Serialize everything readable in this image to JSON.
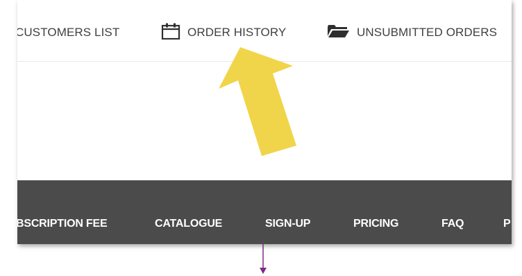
{
  "top_nav": {
    "customers_list": "CUSTOMERS LIST",
    "order_history": "ORDER HISTORY",
    "unsubmitted_orders": "UNSUBMITTED ORDERS",
    "icons": {
      "order_history": "calendar-icon",
      "unsubmitted_orders": "folder-open-icon"
    }
  },
  "main_nav": {
    "items": [
      {
        "label": "BSCRIPTION FEE"
      },
      {
        "label": "CATALOGUE"
      },
      {
        "label": "SIGN-UP"
      },
      {
        "label": "PRICING"
      },
      {
        "label": "FAQ"
      },
      {
        "label": "P"
      }
    ]
  },
  "annotations": {
    "highlight_arrow": "yellow-arrow",
    "pointer": "purple-down-arrow"
  },
  "colors": {
    "highlight": "#f0d54a",
    "dark_bar": "#4b4b4b",
    "nav_text": "#3f3f3f",
    "pointer": "#7b2d86"
  }
}
